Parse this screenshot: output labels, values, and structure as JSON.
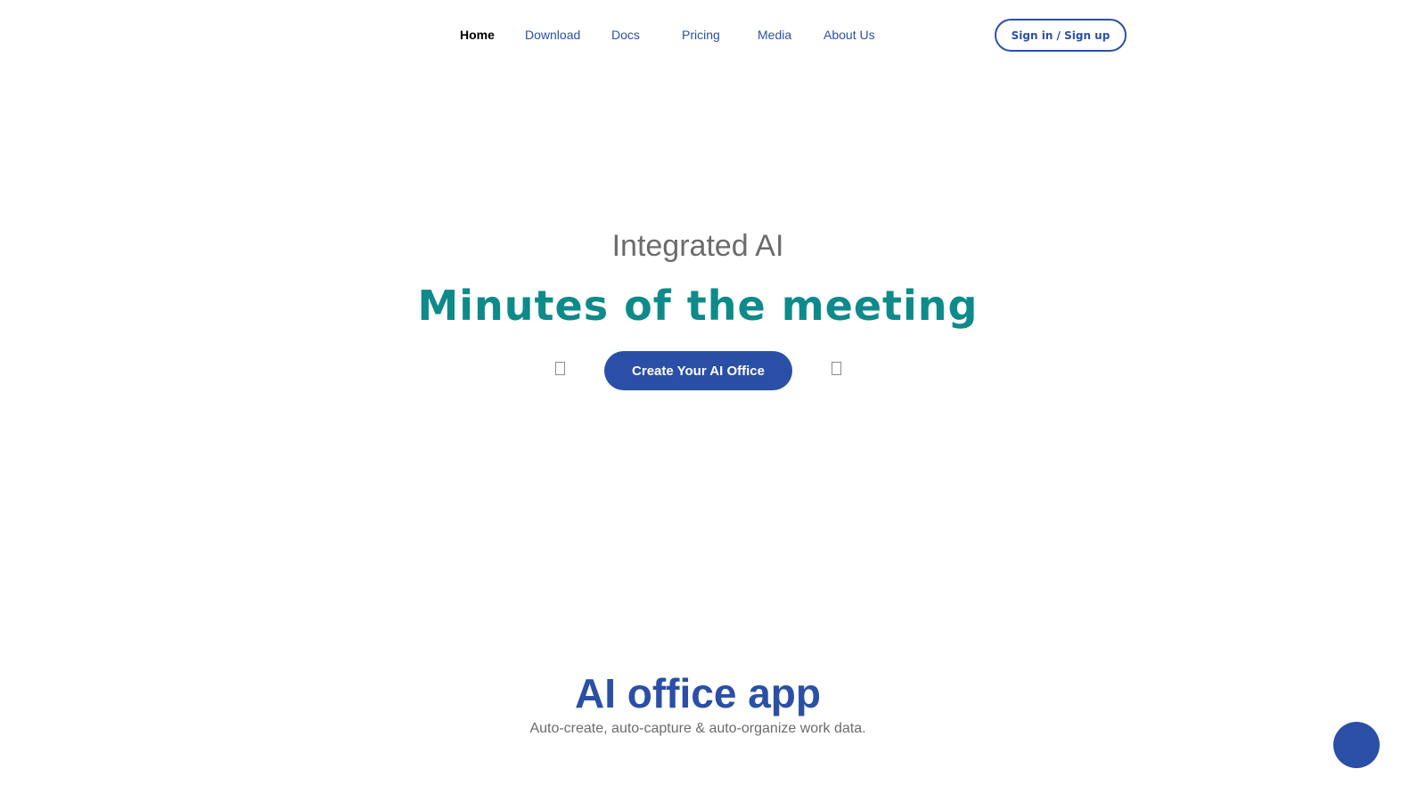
{
  "nav": {
    "items": [
      {
        "label": "Home",
        "active": true
      },
      {
        "label": "Download",
        "active": false
      },
      {
        "label": "Docs",
        "active": false
      },
      {
        "label": "Pricing",
        "active": false
      },
      {
        "label": "Media",
        "active": false
      },
      {
        "label": "About Us",
        "active": false
      }
    ],
    "signin_label": "Sign in / Sign up"
  },
  "hero": {
    "eyebrow": "Integrated AI",
    "title": "Minutes of the meeting",
    "cta_label": "Create Your AI Office",
    "side_glyphs": [
      "missing-glyph-icon",
      "missing-glyph-icon"
    ]
  },
  "section": {
    "title": "AI office app",
    "subtitle": "Auto-create, auto-capture & auto-organize work data."
  },
  "chat": {
    "icon": "chat-bubble-icon"
  },
  "colors": {
    "brand_blue": "#2b4fa6",
    "hero_teal": "#0f8a8a",
    "muted_text": "#6b6b6b",
    "active_nav": "#000000",
    "background": "#ffffff"
  }
}
